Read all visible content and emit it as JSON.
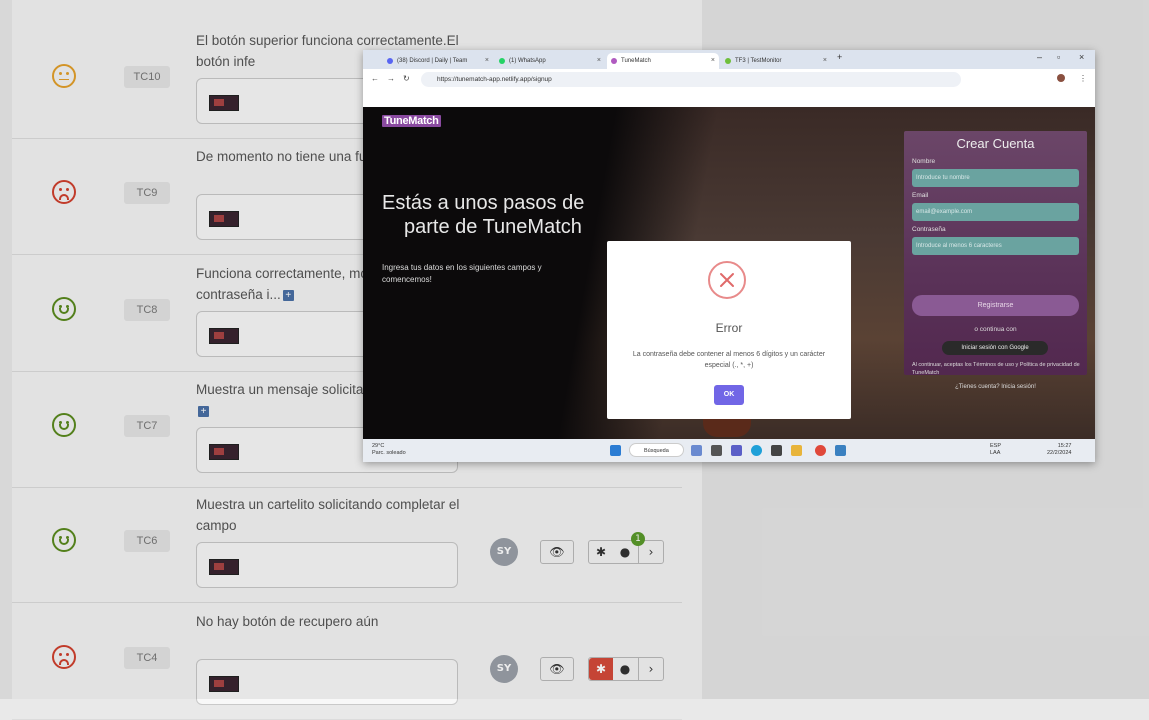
{
  "rows": [
    {
      "face": "meh",
      "color": "#e3a02a",
      "tc": "TC10",
      "desc": "El botón superior funciona correctamente.El botón infe",
      "plus": false
    },
    {
      "face": "sad",
      "color": "#d0402e",
      "tc": "TC9",
      "desc": "De momento no tiene una fu determinada",
      "plus": false
    },
    {
      "face": "happy",
      "color": "#5a8a1e",
      "tc": "TC8",
      "desc": "Funciona correctamente, mo mensaje de contraseña i...",
      "plus": true
    },
    {
      "face": "happy",
      "color": "#5a8a1e",
      "tc": "TC7",
      "desc": "Muestra un mensaje solicita este campo vacío\"",
      "plus": true
    },
    {
      "face": "happy",
      "color": "#5a8a1e",
      "tc": "TC6",
      "desc": "Muestra un cartelito solicitando completar el campo",
      "plus": false,
      "avatar": "SY",
      "badge": "1"
    },
    {
      "face": "sad",
      "color": "#d0402e",
      "tc": "TC4",
      "desc": "No hay botón de recupero aún",
      "plus": false,
      "avatar": "SY"
    }
  ],
  "browser": {
    "tabs": [
      {
        "label": "(38) Discord | Daily | Team",
        "color": "#5865f2"
      },
      {
        "label": "(1) WhatsApp",
        "color": "#25d366"
      },
      {
        "label": "TuneMatch",
        "color": "#b05ac0"
      },
      {
        "label": "TF3 | TestMonitor",
        "color": "#6fbf3a"
      }
    ],
    "url": "https://tunematch-app.netlify.app/signup"
  },
  "site": {
    "logo": "TuneMatch",
    "headline1": "Estás a unos pasos de",
    "headline2": "parte de TuneMatch",
    "subtitle": "Ingresa tus datos en los siguientes campos y comencemos!",
    "form": {
      "title": "Crear Cuenta",
      "name_label": "Nombre",
      "name_placeholder": "Introduce tu nombre",
      "email_label": "Email",
      "email_placeholder": "email@example.com",
      "pass_label": "Contraseña",
      "pass_placeholder": "Introduce al menos 6 caracteres",
      "register": "Registrarse",
      "or": "o continua con",
      "google": "Iniciar sesión con Google",
      "terms": "Al continuar, aceptas los Términos de uso y Política de privacidad de TuneMatch",
      "has_account": "¿Tienes cuenta? Inicia sesión!"
    }
  },
  "modal": {
    "title": "Error",
    "message": "La contraseña debe contener al menos 6 dígitos y un carácter especial (., *, +)",
    "ok": "OK"
  },
  "taskbar": {
    "temp": "29°C",
    "weather": "Parc. soleado",
    "search": "Búsqueda",
    "lang1": "ESP",
    "lang2": "LAA",
    "time": "15:27",
    "date": "22/2/2024"
  }
}
